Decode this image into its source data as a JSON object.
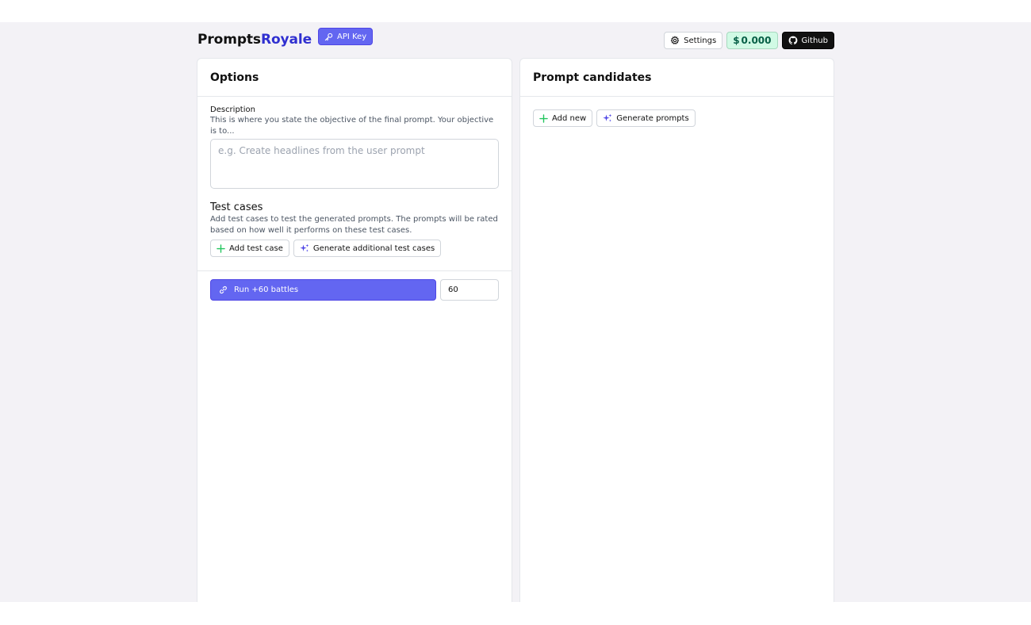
{
  "header": {
    "brand_primary": "Prompts",
    "brand_accent": "Royale",
    "api_key_label": "API Key",
    "settings_label": "Settings",
    "cost_currency": "$",
    "cost_value": "0.000",
    "github_label": "Github"
  },
  "options": {
    "title": "Options",
    "description_label": "Description",
    "description_help": "This is where you state the objective of the final prompt. Your objective is to...",
    "description_placeholder": "e.g. Create headlines from the user prompt",
    "description_value": "",
    "test_cases_title": "Test cases",
    "test_cases_help": "Add test cases to test the generated prompts. The prompts will be rated based on how well it performs on these test cases.",
    "add_test_case_label": "Add test case",
    "generate_test_cases_label": "Generate additional test cases",
    "run_label": "Run +60 battles",
    "battles_value": "60"
  },
  "candidates": {
    "title": "Prompt candidates",
    "add_new_label": "Add new",
    "generate_label": "Generate prompts"
  },
  "colors": {
    "accent": "#6366f1",
    "brand_accent": "#2f2fd0",
    "plus_icon": "#22c55e",
    "cost_bg": "#d1fae5"
  },
  "icons": [
    "key-icon",
    "gear-icon",
    "dollar-icon",
    "github-icon",
    "plus-icon",
    "sparkles-icon",
    "link-icon"
  ]
}
